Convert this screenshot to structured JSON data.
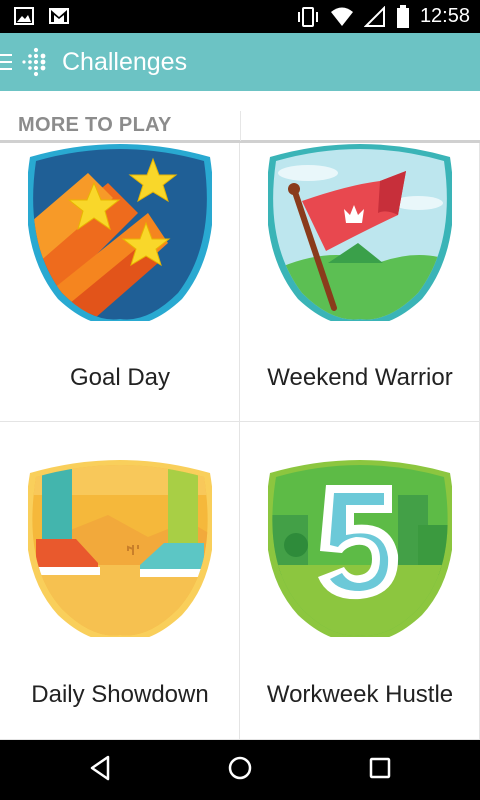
{
  "status_bar": {
    "time": "12:58",
    "icons": [
      "image-icon",
      "gmail-icon",
      "vibrate-icon",
      "wifi-icon",
      "signal-icon",
      "battery-icon"
    ]
  },
  "app_bar": {
    "title": "Challenges",
    "color": "#6cc3c4"
  },
  "section": {
    "title": "MORE TO PLAY"
  },
  "challenges": [
    {
      "name": "Goal Day",
      "badge": "stars-badge-icon"
    },
    {
      "name": "Weekend Warrior",
      "badge": "flag-crown-badge-icon"
    },
    {
      "name": "Daily Showdown",
      "badge": "sneakers-badge-icon"
    },
    {
      "name": "Workweek Hustle",
      "badge": "number-five-badge-icon"
    }
  ],
  "nav_bar": {
    "icons": [
      "back-icon",
      "home-icon",
      "recents-icon"
    ]
  }
}
